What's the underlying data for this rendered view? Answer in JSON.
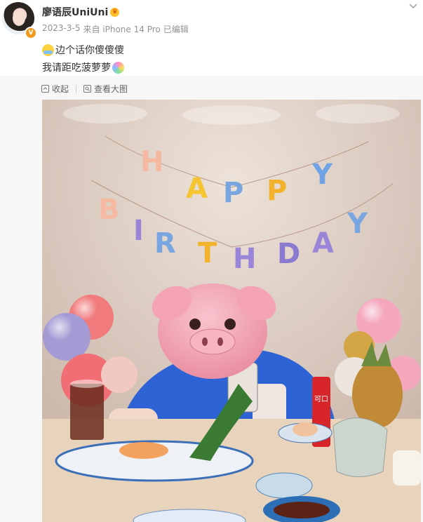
{
  "author": {
    "name": "廖语辰UniUni",
    "verified_badge": "V",
    "crown_icon": "crown-icon"
  },
  "meta": {
    "date": "2023-3-5",
    "source": "来自 iPhone 14 Pro",
    "edited": "已编辑"
  },
  "content": {
    "line1": "边个话你傻傻傻",
    "line2": "我请距吃菠萝萝",
    "emoji1": "sweat-smile-emoji",
    "emoji2": "hug-rainbow-emoji"
  },
  "actions": {
    "collapse_label": "收起",
    "view_large_label": "查看大图"
  },
  "photo": {
    "banner_line1": "HAPPY",
    "banner_line2": "BIRTHDAY",
    "can_logo": "可口可乐"
  },
  "colors": {
    "name": "#333333",
    "meta": "#939393",
    "badge": "#f29a1b",
    "action": "#636363"
  }
}
